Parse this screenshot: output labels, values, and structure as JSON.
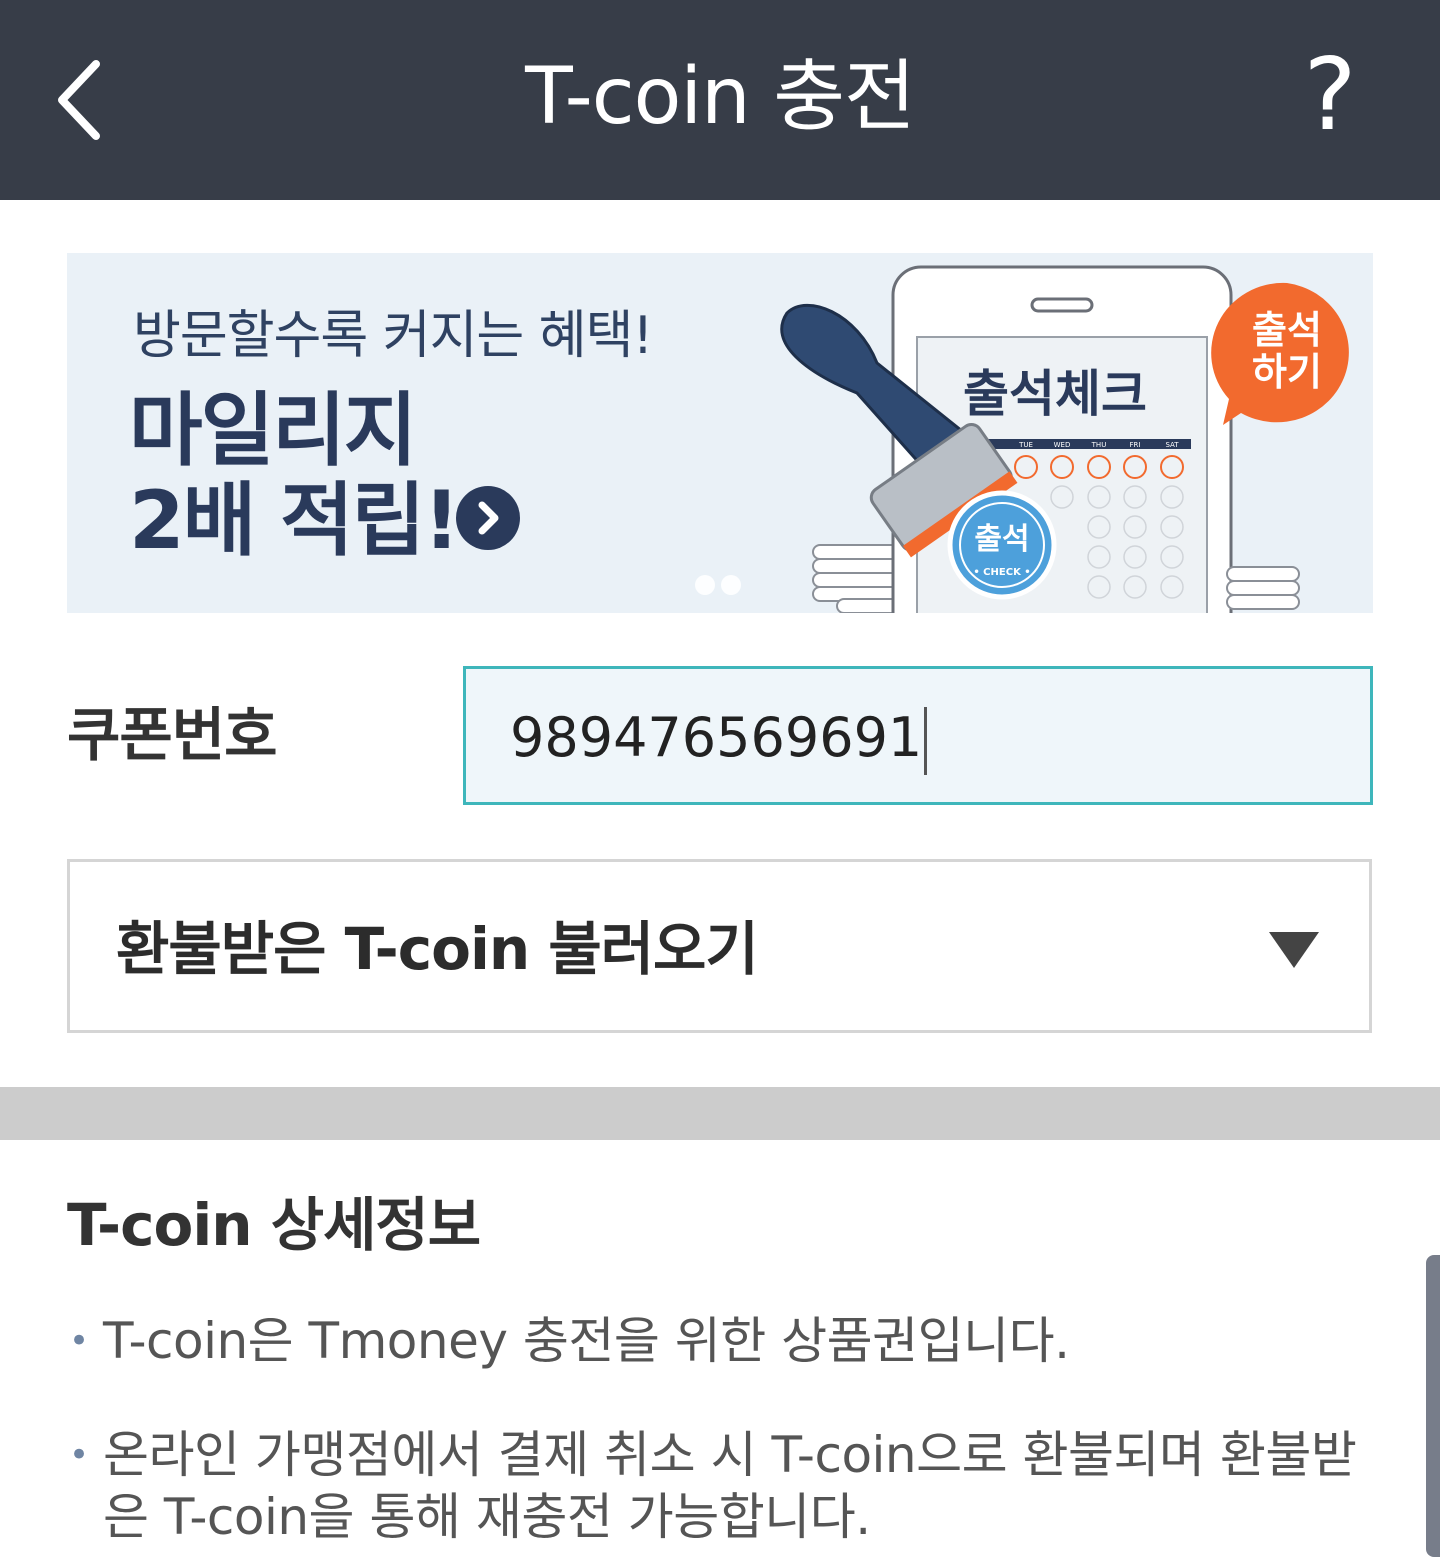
{
  "header": {
    "title": "T-coin 충전",
    "back_icon": "chevron-left-icon",
    "help_label": "?"
  },
  "banner": {
    "subtitle": "방문할수록 커지는 혜택!",
    "headline_line1": "마일리지",
    "headline_line2": "2배 적립!",
    "card_title": "출석체크",
    "bubble_text_line1": "출석",
    "bubble_text_line2": "하기",
    "stamp_text": "출석",
    "stamp_subtext": "• CHECK •",
    "weekdays": [
      "TUE",
      "WED",
      "THU",
      "FRI",
      "SAT"
    ],
    "accent_color": "#f26a2e",
    "navy_color": "#2a3a5b"
  },
  "coupon": {
    "label": "쿠폰번호",
    "value": "989476569691"
  },
  "refund_dropdown": {
    "label": "환불받은 T-coin 불러오기"
  },
  "info": {
    "title": "T-coin 상세정보",
    "bullet": "•",
    "items": [
      "T-coin은 Tmoney 충전을 위한 상품권입니다.",
      "온라인 가맹점에서 결제 취소 시 T-coin으로 환불되며 환불받은 T-coin을 통해 재충전 가능합니다."
    ]
  }
}
